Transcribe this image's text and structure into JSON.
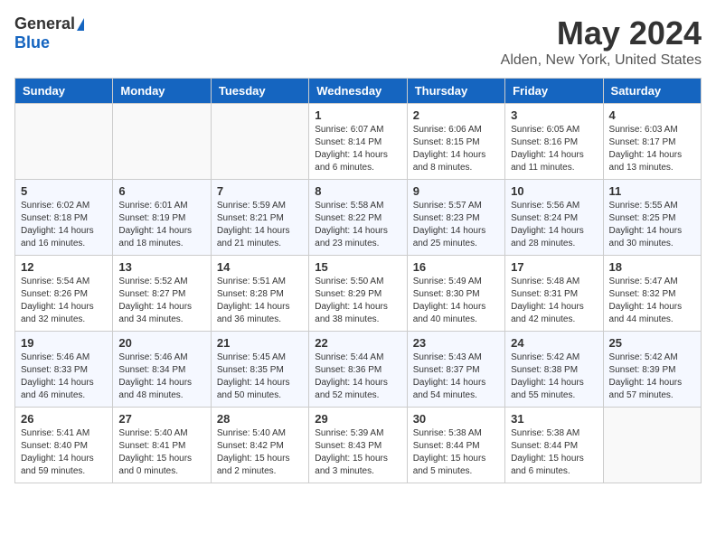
{
  "logo": {
    "general": "General",
    "blue": "Blue"
  },
  "title": "May 2024",
  "subtitle": "Alden, New York, United States",
  "days_of_week": [
    "Sunday",
    "Monday",
    "Tuesday",
    "Wednesday",
    "Thursday",
    "Friday",
    "Saturday"
  ],
  "weeks": [
    [
      {
        "day": "",
        "detail": ""
      },
      {
        "day": "",
        "detail": ""
      },
      {
        "day": "",
        "detail": ""
      },
      {
        "day": "1",
        "detail": "Sunrise: 6:07 AM\nSunset: 8:14 PM\nDaylight: 14 hours\nand 6 minutes."
      },
      {
        "day": "2",
        "detail": "Sunrise: 6:06 AM\nSunset: 8:15 PM\nDaylight: 14 hours\nand 8 minutes."
      },
      {
        "day": "3",
        "detail": "Sunrise: 6:05 AM\nSunset: 8:16 PM\nDaylight: 14 hours\nand 11 minutes."
      },
      {
        "day": "4",
        "detail": "Sunrise: 6:03 AM\nSunset: 8:17 PM\nDaylight: 14 hours\nand 13 minutes."
      }
    ],
    [
      {
        "day": "5",
        "detail": "Sunrise: 6:02 AM\nSunset: 8:18 PM\nDaylight: 14 hours\nand 16 minutes."
      },
      {
        "day": "6",
        "detail": "Sunrise: 6:01 AM\nSunset: 8:19 PM\nDaylight: 14 hours\nand 18 minutes."
      },
      {
        "day": "7",
        "detail": "Sunrise: 5:59 AM\nSunset: 8:21 PM\nDaylight: 14 hours\nand 21 minutes."
      },
      {
        "day": "8",
        "detail": "Sunrise: 5:58 AM\nSunset: 8:22 PM\nDaylight: 14 hours\nand 23 minutes."
      },
      {
        "day": "9",
        "detail": "Sunrise: 5:57 AM\nSunset: 8:23 PM\nDaylight: 14 hours\nand 25 minutes."
      },
      {
        "day": "10",
        "detail": "Sunrise: 5:56 AM\nSunset: 8:24 PM\nDaylight: 14 hours\nand 28 minutes."
      },
      {
        "day": "11",
        "detail": "Sunrise: 5:55 AM\nSunset: 8:25 PM\nDaylight: 14 hours\nand 30 minutes."
      }
    ],
    [
      {
        "day": "12",
        "detail": "Sunrise: 5:54 AM\nSunset: 8:26 PM\nDaylight: 14 hours\nand 32 minutes."
      },
      {
        "day": "13",
        "detail": "Sunrise: 5:52 AM\nSunset: 8:27 PM\nDaylight: 14 hours\nand 34 minutes."
      },
      {
        "day": "14",
        "detail": "Sunrise: 5:51 AM\nSunset: 8:28 PM\nDaylight: 14 hours\nand 36 minutes."
      },
      {
        "day": "15",
        "detail": "Sunrise: 5:50 AM\nSunset: 8:29 PM\nDaylight: 14 hours\nand 38 minutes."
      },
      {
        "day": "16",
        "detail": "Sunrise: 5:49 AM\nSunset: 8:30 PM\nDaylight: 14 hours\nand 40 minutes."
      },
      {
        "day": "17",
        "detail": "Sunrise: 5:48 AM\nSunset: 8:31 PM\nDaylight: 14 hours\nand 42 minutes."
      },
      {
        "day": "18",
        "detail": "Sunrise: 5:47 AM\nSunset: 8:32 PM\nDaylight: 14 hours\nand 44 minutes."
      }
    ],
    [
      {
        "day": "19",
        "detail": "Sunrise: 5:46 AM\nSunset: 8:33 PM\nDaylight: 14 hours\nand 46 minutes."
      },
      {
        "day": "20",
        "detail": "Sunrise: 5:46 AM\nSunset: 8:34 PM\nDaylight: 14 hours\nand 48 minutes."
      },
      {
        "day": "21",
        "detail": "Sunrise: 5:45 AM\nSunset: 8:35 PM\nDaylight: 14 hours\nand 50 minutes."
      },
      {
        "day": "22",
        "detail": "Sunrise: 5:44 AM\nSunset: 8:36 PM\nDaylight: 14 hours\nand 52 minutes."
      },
      {
        "day": "23",
        "detail": "Sunrise: 5:43 AM\nSunset: 8:37 PM\nDaylight: 14 hours\nand 54 minutes."
      },
      {
        "day": "24",
        "detail": "Sunrise: 5:42 AM\nSunset: 8:38 PM\nDaylight: 14 hours\nand 55 minutes."
      },
      {
        "day": "25",
        "detail": "Sunrise: 5:42 AM\nSunset: 8:39 PM\nDaylight: 14 hours\nand 57 minutes."
      }
    ],
    [
      {
        "day": "26",
        "detail": "Sunrise: 5:41 AM\nSunset: 8:40 PM\nDaylight: 14 hours\nand 59 minutes."
      },
      {
        "day": "27",
        "detail": "Sunrise: 5:40 AM\nSunset: 8:41 PM\nDaylight: 15 hours\nand 0 minutes."
      },
      {
        "day": "28",
        "detail": "Sunrise: 5:40 AM\nSunset: 8:42 PM\nDaylight: 15 hours\nand 2 minutes."
      },
      {
        "day": "29",
        "detail": "Sunrise: 5:39 AM\nSunset: 8:43 PM\nDaylight: 15 hours\nand 3 minutes."
      },
      {
        "day": "30",
        "detail": "Sunrise: 5:38 AM\nSunset: 8:44 PM\nDaylight: 15 hours\nand 5 minutes."
      },
      {
        "day": "31",
        "detail": "Sunrise: 5:38 AM\nSunset: 8:44 PM\nDaylight: 15 hours\nand 6 minutes."
      },
      {
        "day": "",
        "detail": ""
      }
    ]
  ]
}
